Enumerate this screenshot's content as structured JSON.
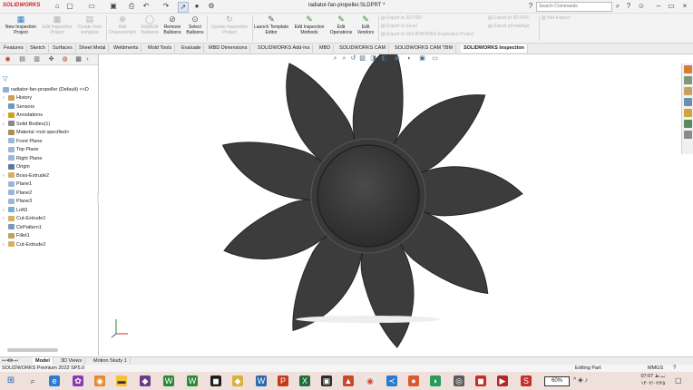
{
  "app": {
    "brand": "SOLIDWORKS",
    "document_title": "radiator-fan-propeller.SLDPRT *",
    "search_placeholder": "Search Commands"
  },
  "ribbon": {
    "buttons": [
      {
        "label": "New Inspection Project",
        "enabled": true,
        "icon": "new-inspection-icon"
      },
      {
        "label": "Edit Inspection Project",
        "enabled": false,
        "icon": "edit-inspection-icon"
      },
      {
        "label": "Create from template",
        "enabled": false,
        "icon": "template-icon"
      },
      {
        "label": "Add Characteristic",
        "enabled": false,
        "icon": "characteristic-icon"
      },
      {
        "label": "Add/Edit Balloons",
        "enabled": false,
        "icon": "balloon-icon"
      },
      {
        "label": "Remove Balloons",
        "enabled": true,
        "icon": "remove-balloon-icon"
      },
      {
        "label": "Select Balloons",
        "enabled": true,
        "icon": "select-balloon-icon"
      },
      {
        "label": "Update Inspection Project",
        "enabled": false,
        "icon": "update-icon"
      },
      {
        "label": "Launch Template Editor",
        "enabled": true,
        "icon": "template-editor-icon"
      },
      {
        "label": "Edit Inspection Methods",
        "enabled": true,
        "icon": "methods-icon"
      },
      {
        "label": "Edit Operations",
        "enabled": true,
        "icon": "operations-icon"
      },
      {
        "label": "Edit Vendors",
        "enabled": true,
        "icon": "vendors-icon"
      }
    ],
    "export_list_1": [
      "Export to 2D PDF",
      "Export to Excel",
      "Export to SOLIDWORKS Inspection Project"
    ],
    "export_list_2": [
      "Export to 3D PDF",
      "Export eDrawings"
    ],
    "export_list_3": [
      "Net-Inspect"
    ]
  },
  "tabs": [
    "Features",
    "Sketch",
    "Surfaces",
    "Sheet Metal",
    "Weldments",
    "Mold Tools",
    "Evaluate",
    "MBD Dimensions",
    "SOLIDWORKS Add-Ins",
    "MBD",
    "SOLIDWORKS CAM",
    "SOLIDWORKS CAM TBM",
    "SOLIDWORKS Inspection"
  ],
  "active_tab": "SOLIDWORKS Inspection",
  "feature_tree": {
    "root": "radiator-fan-propeller (Default) <<D",
    "items": [
      {
        "label": "History",
        "icon": "history-icon",
        "expandable": true
      },
      {
        "label": "Sensors",
        "icon": "sensors-icon",
        "expandable": false
      },
      {
        "label": "Annotations",
        "icon": "annotations-icon",
        "expandable": true
      },
      {
        "label": "Solid Bodies(1)",
        "icon": "solid-bodies-icon",
        "expandable": true
      },
      {
        "label": "Material <not specified>",
        "icon": "material-icon",
        "expandable": false
      },
      {
        "label": "Front Plane",
        "icon": "plane-icon",
        "expandable": false
      },
      {
        "label": "Top Plane",
        "icon": "plane-icon",
        "expandable": false
      },
      {
        "label": "Right Plane",
        "icon": "plane-icon",
        "expandable": false
      },
      {
        "label": "Origin",
        "icon": "origin-icon",
        "expandable": false
      },
      {
        "label": "Boss-Extrude2",
        "icon": "extrude-icon",
        "expandable": true
      },
      {
        "label": "Plane1",
        "icon": "plane-icon",
        "expandable": false
      },
      {
        "label": "Plane2",
        "icon": "plane-icon",
        "expandable": false
      },
      {
        "label": "Plane3",
        "icon": "plane-icon",
        "expandable": false
      },
      {
        "label": "Loft3",
        "icon": "loft-icon",
        "expandable": true
      },
      {
        "label": "Cut-Extrude1",
        "icon": "cut-extrude-icon",
        "expandable": true
      },
      {
        "label": "CirPattern1",
        "icon": "pattern-icon",
        "expandable": false
      },
      {
        "label": "Fillet1",
        "icon": "fillet-icon",
        "expandable": false
      },
      {
        "label": "Cut-Extrude2",
        "icon": "cut-extrude-icon",
        "expandable": true
      }
    ]
  },
  "bottom_tabs": [
    "Model",
    "3D Views",
    "Motion Study 1"
  ],
  "active_bottom_tab": "Model",
  "status": {
    "left": "SOLIDWORKS Premium 2022 SP5.0",
    "mode": "Editing Part",
    "units": "MMGS"
  },
  "taskbar": {
    "battery": "60%",
    "time": "07:07 ب.ظ",
    "date": "۱۴۰۲/۰۲/۲۵"
  },
  "colors": {
    "ribbon_bg": "#f3f3f3",
    "brand_red": "#d21f26",
    "fan": "#3a3a3a",
    "taskbar_bg": "#f0e0dc"
  }
}
